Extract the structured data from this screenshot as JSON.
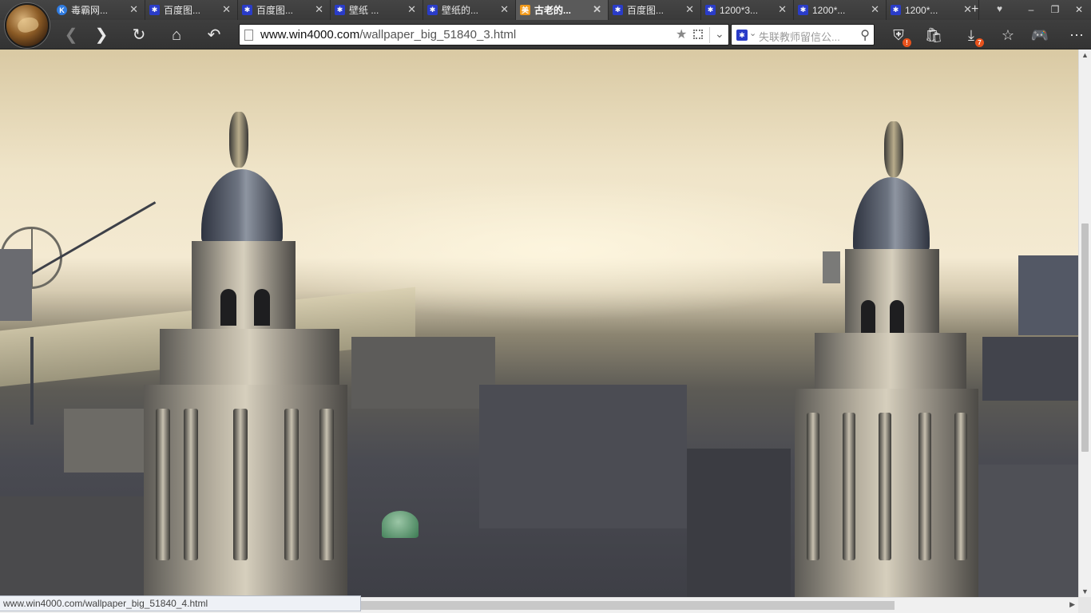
{
  "browser": {
    "logo": "browser-logo-icon",
    "tabs": [
      {
        "label": "毒霸网...",
        "icon": "k-icon",
        "active": false
      },
      {
        "label": "百度图...",
        "icon": "paw-icon",
        "active": false
      },
      {
        "label": "百度图...",
        "icon": "paw-icon",
        "active": false
      },
      {
        "label": "壁纸 ...",
        "icon": "paw-icon",
        "active": false
      },
      {
        "label": "壁纸的...",
        "icon": "paw-icon",
        "active": false
      },
      {
        "label": "古老的...",
        "icon": "meitu-icon",
        "active": true
      },
      {
        "label": "百度图...",
        "icon": "paw-icon",
        "active": false
      },
      {
        "label": "1200*3...",
        "icon": "paw-icon",
        "active": false
      },
      {
        "label": "1200*...",
        "icon": "paw-icon",
        "active": false
      },
      {
        "label": "1200*...",
        "icon": "paw-icon",
        "active": false
      }
    ],
    "tab_close_glyph": "✕",
    "new_tab_glyph": "+"
  },
  "toolbar": {
    "back_glyph": "❮",
    "forward_glyph": "❯",
    "refresh_glyph": "↻",
    "home_glyph": "⌂",
    "undo_glyph": "↶",
    "address": {
      "host": "www.win4000.com",
      "path": "/wallpaper_big_51840_3.html"
    },
    "search": {
      "placeholder": "失联教师留信公..."
    },
    "download_badge": "7",
    "shield_badge": "!"
  },
  "content": {
    "description_icon": "wallpaper-image"
  },
  "status": {
    "hover_url": "www.win4000.com/wallpaper_big_51840_4.html"
  },
  "colors": {
    "chrome_dark": "#3a3a3a",
    "active_tab": "#5a5a5a",
    "badge": "#e8521c",
    "search_engine": "#2a3cc8"
  }
}
